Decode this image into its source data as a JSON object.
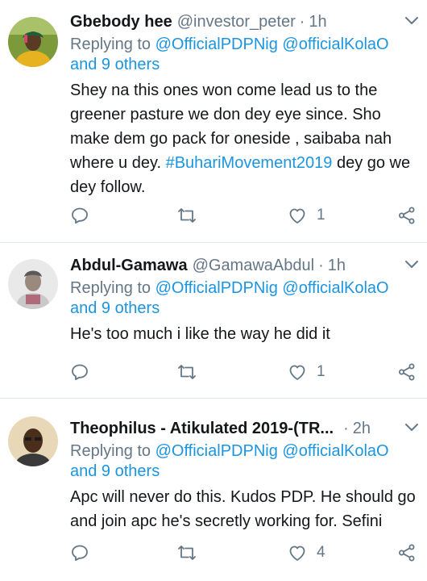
{
  "tweets": [
    {
      "name": "Gbebody hee",
      "handle": "@investor_peter",
      "sep": "·",
      "time": "1h",
      "replying_prefix": "Replying to ",
      "mention1": "@OfficialPDPNig",
      "mention2": "@officialKolaO",
      "others": "and 9 others",
      "text_part1": "Shey na this ones won come lead us to the greener pasture we don dey eye since. Sho make dem go pack for oneside , saibaba nah where u dey. ",
      "hashtag": "#BuhariMovement2019",
      "text_part2": " dey go we dey follow.",
      "likes": "1"
    },
    {
      "name": "Abdul-Gamawa",
      "handle": "@GamawaAbdul",
      "sep": "·",
      "time": "1h",
      "replying_prefix": "Replying to ",
      "mention1": "@OfficialPDPNig",
      "mention2": "@officialKolaO",
      "others": "and 9 others",
      "text": "He's too much i like the way he did it",
      "likes": "1"
    },
    {
      "name": "Theophilus - Atikulated 2019-(TR...",
      "sep": "·",
      "time": "2h",
      "replying_prefix": "Replying to ",
      "mention1": "@OfficialPDPNig",
      "mention2": "@officialKolaO",
      "others": "and 9 others",
      "text": "Apc will never do this. Kudos PDP. He should go and join apc he's secretly working for. Sefini",
      "likes": "4"
    }
  ],
  "icons": [
    "reply-icon",
    "retweet-icon",
    "like-icon",
    "share-icon",
    "caret-down-icon"
  ],
  "colors": {
    "link": "#1b95e0",
    "secondary": "#657786",
    "divider": "#e1e8ed",
    "text": "#14171a"
  }
}
